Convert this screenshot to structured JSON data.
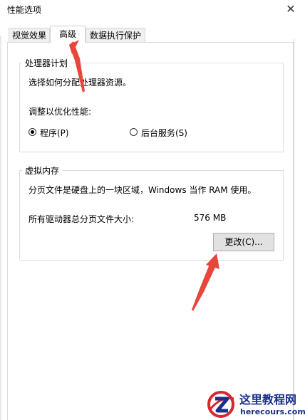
{
  "window": {
    "title": "性能选项",
    "close_glyph": "✕"
  },
  "tabs": [
    {
      "label": "视觉效果",
      "selected": false
    },
    {
      "label": "高级",
      "selected": true
    },
    {
      "label": "数据执行保护",
      "selected": false
    }
  ],
  "processor": {
    "group_title": "处理器计划",
    "description": "选择如何分配处理器资源。",
    "adjust_label": "调整以优化性能:",
    "options": [
      {
        "label": "程序(P)",
        "selected": true
      },
      {
        "label": "后台服务(S)",
        "selected": false
      }
    ]
  },
  "virtual_memory": {
    "group_title": "虚拟内存",
    "description": "分页文件是硬盘上的一块区域，Windows 当作 RAM 使用。",
    "total_label": "所有驱动器总分页文件大小:",
    "total_value": "576 MB",
    "change_button": "更改(C)..."
  },
  "watermark": {
    "name": "这里教程网",
    "url": "herecours.com"
  },
  "colors": {
    "annotation_arrow": "#e8463a",
    "watermark_blue": "#1a2f8a",
    "watermark_red": "#d8262c"
  }
}
